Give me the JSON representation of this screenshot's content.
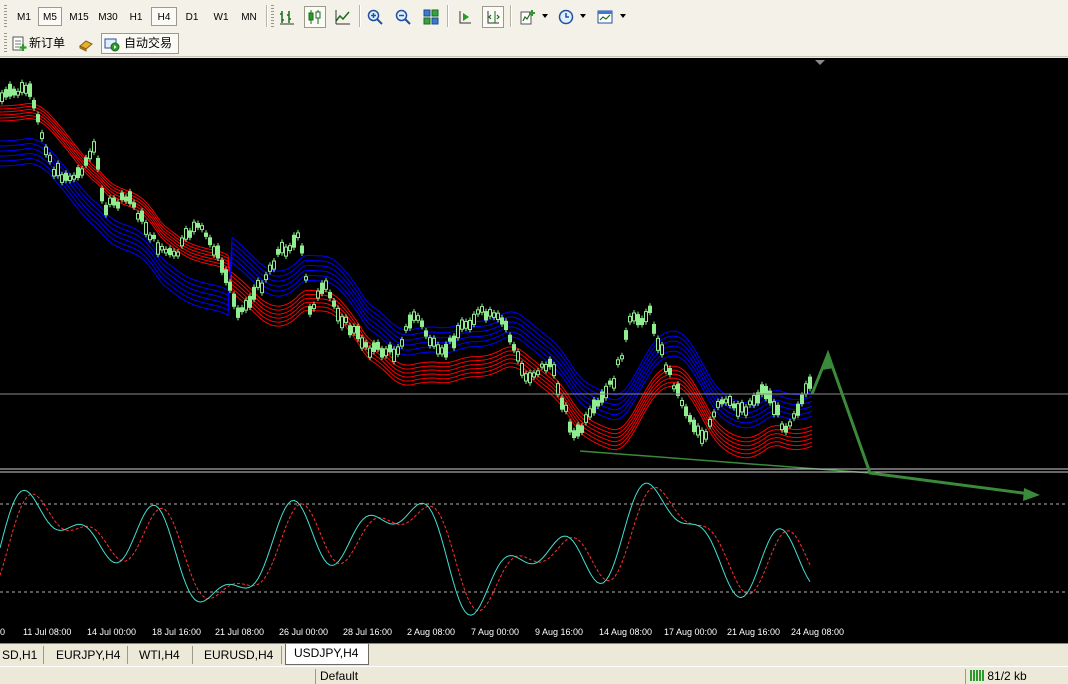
{
  "toolbar": {
    "timeframes": [
      "M1",
      "M5",
      "M15",
      "M30",
      "H1",
      "H4",
      "D1",
      "W1",
      "MN"
    ],
    "active_timeframe": "H4"
  },
  "toolbar2": {
    "new_order_label": "新订单",
    "auto_trading_label": "自动交易"
  },
  "chart": {
    "date_labels": [
      "11 Jul 08:00",
      "14 Jul 00:00",
      "18 Jul 16:00",
      "21 Jul 08:00",
      "26 Jul 00:00",
      "28 Jul 16:00",
      "2 Aug 08:00",
      "7 Aug 00:00",
      "9 Aug 16:00",
      "14 Aug 08:00",
      "17 Aug 00:00",
      "21 Aug 16:00",
      "24 Aug 08:00"
    ],
    "colors": {
      "background": "#000000",
      "candles": "#90ee90",
      "ribbon_red": "#ff0000",
      "ribbon_blue": "#0000ff",
      "stoch_main": "#40e0d0",
      "stoch_signal": "#ff3030",
      "arrow": "#3a8a3a"
    }
  },
  "tabs": [
    "SD,H1",
    "EURJPY,H4",
    "WTI,H4",
    "EURUSD,H4",
    "USDJPY,H4"
  ],
  "active_tab": "USDJPY,H4",
  "status": {
    "profile": "Default",
    "traffic": "81/2 kb"
  }
}
